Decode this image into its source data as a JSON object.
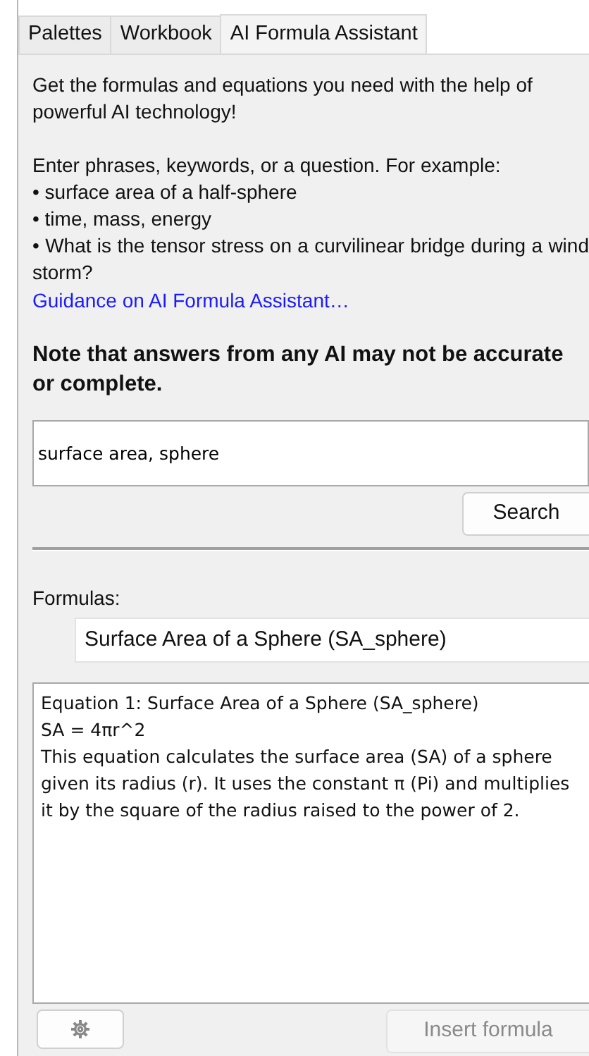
{
  "tabs": [
    {
      "label": "Palettes",
      "selected": false
    },
    {
      "label": "Workbook",
      "selected": false
    },
    {
      "label": "AI Formula Assistant",
      "selected": true
    }
  ],
  "intro": "Get the formulas and equations you need with the help of powerful AI technology!",
  "examples_heading": "Enter phrases, keywords, or a question. For example:",
  "examples": [
    "surface area of a half-sphere",
    "time, mass, energy",
    "What is the tensor stress on a curvilinear bridge during a wind storm?"
  ],
  "bullet": "•",
  "guidance_link": "Guidance on AI Formula Assistant…",
  "note": "Note that answers from any AI may not be accurate or complete.",
  "query": {
    "value": "surface area, sphere"
  },
  "search_button": "Search",
  "formulas_label": "Formulas:",
  "formula_select": "Surface Area of a Sphere (SA_sphere)",
  "result": {
    "title": "Equation 1: Surface Area of a Sphere (SA_sphere)",
    "equation": "SA = 4πr^2",
    "description": "This equation calculates the surface area (SA) of a sphere given its radius (r). It uses the constant π (Pi) and multiplies it by the square of the radius raised to the power of 2."
  },
  "insert_button": {
    "label": "Insert formula",
    "disabled": true
  }
}
